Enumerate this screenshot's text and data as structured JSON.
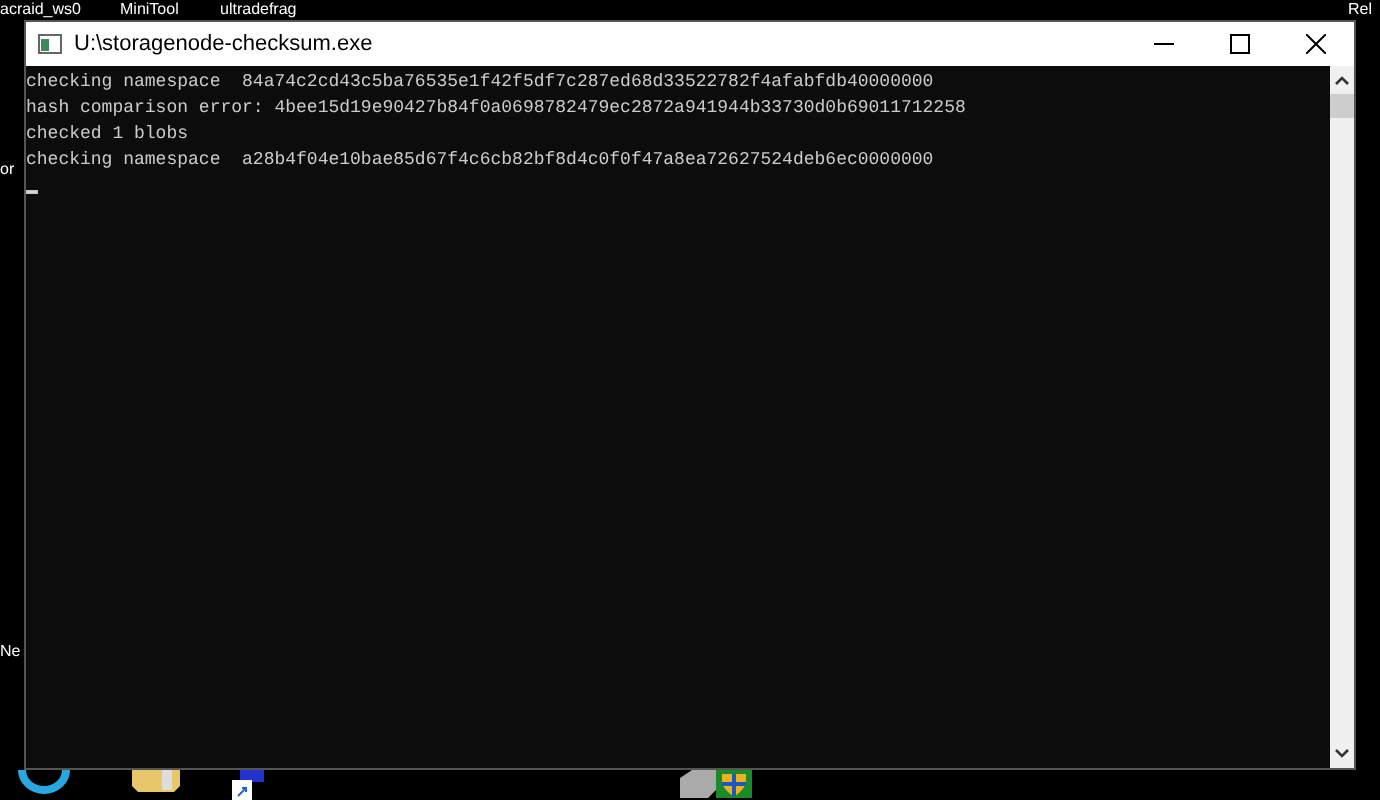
{
  "desktop": {
    "top_labels": [
      "acraid_ws0",
      "MiniTool",
      "ultradefrag",
      "Rel"
    ],
    "side_labels": [
      "or",
      "Ne"
    ]
  },
  "window": {
    "title": "U:\\storagenode-checksum.exe"
  },
  "console": {
    "lines": [
      "checking namespace  84a74c2cd43c5ba76535e1f42f5df7c287ed68d33522782f4afabfdb40000000",
      "hash comparison error: 4bee15d19e90427b84f0a0698782479ec2872a941944b33730d0b69011712258",
      "checked 1 blobs",
      "checking namespace  a28b4f04e10bae85d67f4c6cb82bf8d4c0f0f47a8ea72627524deb6ec0000000"
    ]
  }
}
